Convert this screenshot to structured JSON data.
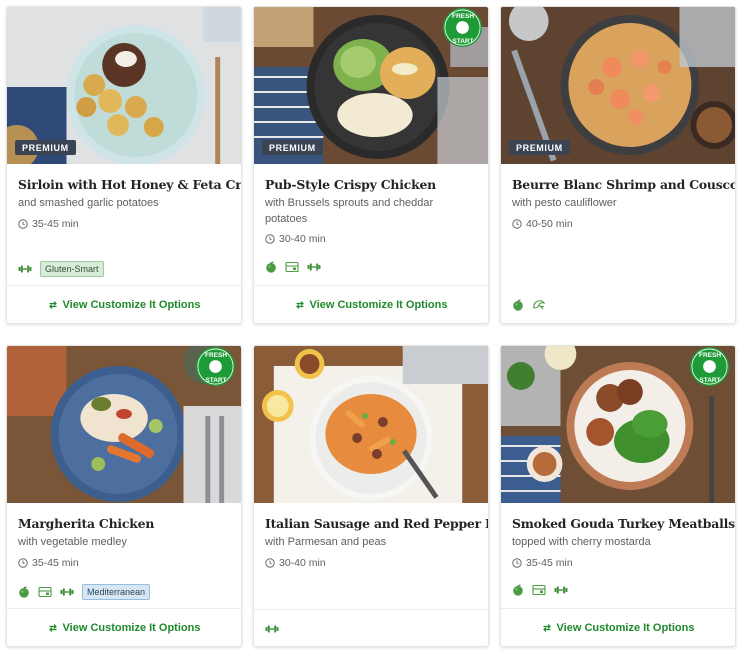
{
  "colors": {
    "brand_green": "#1f8a2b",
    "premium_badge": "#3b4453",
    "gluten_tag": "#d7ecd9",
    "med_tag": "#d6e6f4"
  },
  "fresh_start": {
    "line1": "FRESH",
    "line2": "START"
  },
  "cards": [
    {
      "title": "Sirloin with Hot Honey & Feta Crema",
      "subtitle": "and smashed garlic potatoes",
      "time": "35-45 min",
      "badge": "PREMIUM",
      "tags": [
        "Gluten-Smart"
      ],
      "icons": [
        "dumbbell-icon"
      ],
      "cta": "View Customize It Options"
    },
    {
      "title": "Pub-Style Crispy Chicken",
      "subtitle": "with Brussels sprouts and cheddar potatoes",
      "time": "30-40 min",
      "badge": "PREMIUM",
      "tags": [],
      "icons": [
        "apple-icon",
        "meal-kit-icon",
        "dumbbell-icon"
      ],
      "cta": "View Customize It Options"
    },
    {
      "title": "Beurre Blanc Shrimp and Couscous",
      "subtitle": "with pesto cauliflower",
      "time": "40-50 min",
      "badge": "PREMIUM",
      "tags": [],
      "icons": [
        "apple-icon",
        "seafood-icon"
      ],
      "cta": ""
    },
    {
      "title": "Margherita Chicken",
      "subtitle": "with vegetable medley",
      "time": "35-45 min",
      "badge": "",
      "tags": [
        "Mediterranean"
      ],
      "icons": [
        "apple-icon",
        "meal-kit-icon",
        "dumbbell-icon"
      ],
      "cta": "View Customize It Options"
    },
    {
      "title": "Italian Sausage and Red Pepper Pasta",
      "subtitle": "with Parmesan and peas",
      "time": "30-40 min",
      "badge": "",
      "tags": [],
      "icons": [
        "dumbbell-icon"
      ],
      "cta": ""
    },
    {
      "title": "Smoked Gouda Turkey Meatballs",
      "subtitle": "topped with cherry mostarda",
      "time": "35-45 min",
      "badge": "",
      "tags": [],
      "icons": [
        "apple-icon",
        "meal-kit-icon",
        "dumbbell-icon"
      ],
      "cta": "View Customize It Options"
    }
  ]
}
